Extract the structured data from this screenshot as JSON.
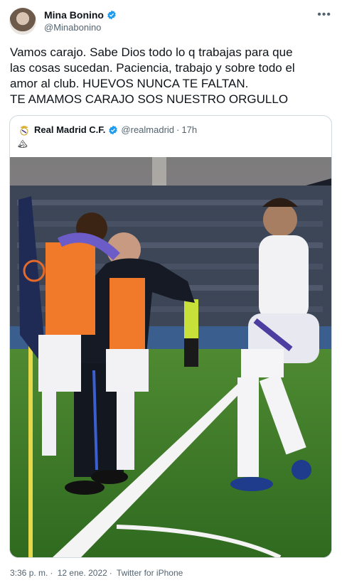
{
  "author": {
    "display_name": "Mina Bonino",
    "handle": "@Minabonino"
  },
  "more_icon": "more-horizontal-icon",
  "tweet_lines": [
    "Vamos carajo. Sabe Dios todo lo q trabajas para que",
    "las cosas sucedan. Paciencia, trabajo y sobre todo el",
    "amor al club. HUEVOS NUNCA TE FALTAN.",
    "TE AMAMOS CARAJO SOS NUESTRO ORGULLO"
  ],
  "quoted": {
    "display_name": "Real Madrid C.F.",
    "handle": "@realmadrid",
    "separator": "·",
    "time": "17h",
    "text_emoji": "🏔"
  },
  "footer": {
    "time": "3:36 p. m.",
    "separator": "·",
    "date": "12 ene. 2022",
    "separator2": "·",
    "source": "Twitter for iPhone"
  },
  "colors": {
    "verified": "#1d9bf0",
    "pitch": "#3f7a2a",
    "kit_white": "#f2f2f5"
  }
}
